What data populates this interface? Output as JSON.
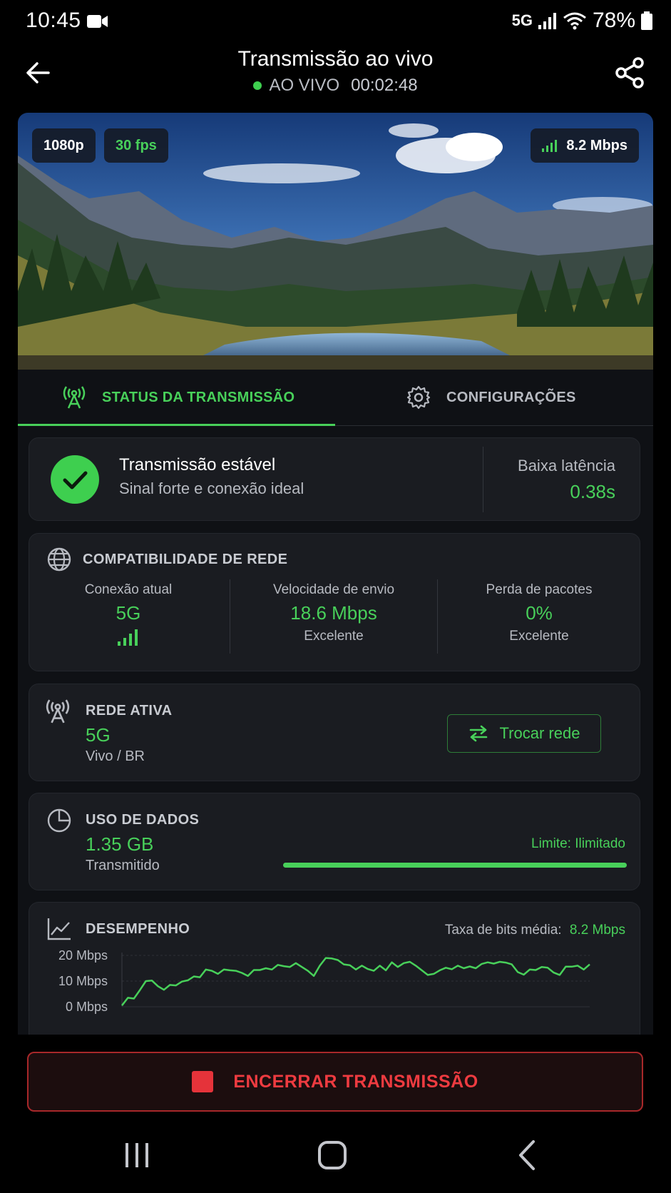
{
  "status_bar": {
    "time": "10:45",
    "network": "5G",
    "battery": "78%"
  },
  "header": {
    "title": "Transmissão ao vivo",
    "live_label": "AO VIVO",
    "timer": "00:02:48",
    "live_color": "#3ecf4f"
  },
  "preview": {
    "resolution": "1080p",
    "fps": "30 fps",
    "bitrate": "8.2 Mbps"
  },
  "tabs": [
    {
      "label": "STATUS DA TRANSMISSÃO",
      "icon": "broadcast-tower-icon",
      "active": true
    },
    {
      "label": "CONFIGURAÇÕES",
      "icon": "gear-icon",
      "active": false
    }
  ],
  "stability": {
    "title": "Transmissão estável",
    "subtitle": "Sinal forte e conexão ideal",
    "latency_label": "Baixa latência",
    "latency_value": "0.38s"
  },
  "compat": {
    "title": "COMPATIBILIDADE DE REDE",
    "columns": [
      {
        "label": "Conexão atual",
        "value": "5G",
        "note": ""
      },
      {
        "label": "Velocidade de envio",
        "value": "18.6 Mbps",
        "note": "Excelente"
      },
      {
        "label": "Perda de pacotes",
        "value": "0%",
        "note": "Excelente"
      }
    ]
  },
  "active_network": {
    "title": "REDE ATIVA",
    "value": "5G",
    "carrier": "Vivo / BR",
    "switch_label": "Trocar rede"
  },
  "data_usage": {
    "title": "USO DE DADOS",
    "value": "1.35 GB",
    "caption": "Transmitido",
    "limit_label": "Limite:",
    "limit_value": "Ilimitado",
    "bar_fill": 1.0
  },
  "performance": {
    "title": "DESEMPENHO",
    "avg_label": "Taxa de bits média:",
    "avg_value": "8.2 Mbps"
  },
  "chart_data": {
    "type": "line",
    "title": "",
    "xlabel": "",
    "ylabel": "",
    "ylim": [
      0,
      20
    ],
    "yticks": [
      "20 Mbps",
      "10 Mbps",
      "0 Mbps"
    ],
    "ytick_values": [
      20,
      10,
      0
    ],
    "grid": true,
    "series": [
      {
        "color": "#48d05a",
        "values": [
          0.5,
          3.5,
          3.2,
          6.5,
          10,
          10.2,
          8,
          6.6,
          8.5,
          8.3,
          9.8,
          10.3,
          11.8,
          11.5,
          14.5,
          14,
          12.8,
          14.5,
          14.2,
          14,
          13.2,
          12,
          14.3,
          14.3,
          15,
          14.5,
          16.3,
          15.8,
          15.5,
          17,
          15.5,
          14,
          12,
          16,
          19,
          18.8,
          18.2,
          16.5,
          16.2,
          14.5,
          16,
          14.7,
          14,
          16,
          14.2,
          17.3,
          15.5,
          17,
          17.5,
          16,
          14.2,
          12.4,
          12.8,
          14.2,
          15.2,
          14.6,
          16,
          15,
          15.7,
          15,
          16.7,
          17.3,
          16.8,
          17.5,
          17.2,
          16.5,
          13.5,
          12.5,
          14.5,
          14.3,
          15.5,
          15.2,
          13.3,
          12.4,
          15.6,
          15.6,
          16,
          14.5,
          16.5
        ]
      }
    ]
  },
  "end_button": {
    "label": "ENCERRAR TRANSMISSÃO"
  }
}
